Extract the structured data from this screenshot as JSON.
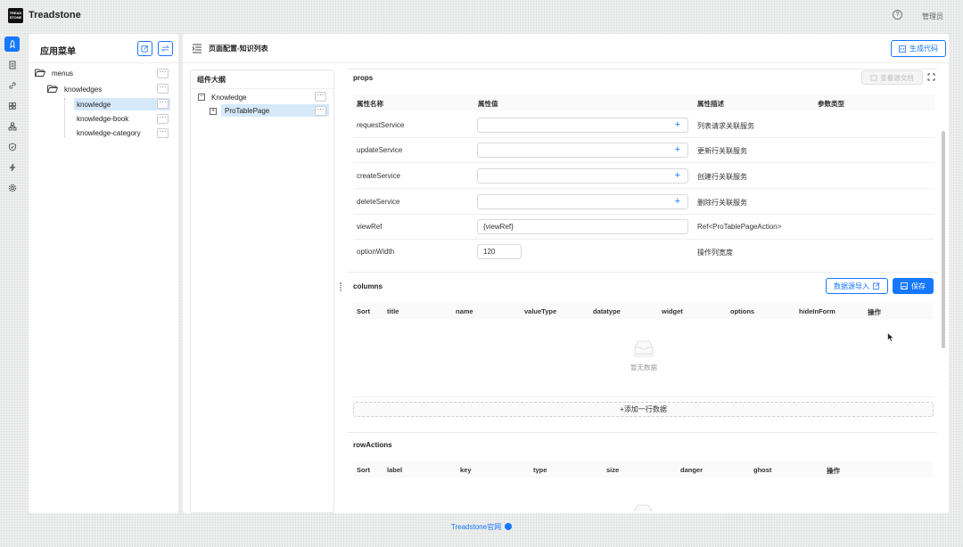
{
  "header": {
    "logo_text": "TREAD STONE",
    "app_title": "Treadstone",
    "user": "管理员"
  },
  "left_panel": {
    "title": "应用菜单",
    "tree": [
      {
        "label": "menus"
      },
      {
        "label": "knowledges"
      },
      {
        "label": "knowledge"
      },
      {
        "label": "knowledge-book"
      },
      {
        "label": "knowledge-category"
      }
    ],
    "more": "···"
  },
  "main": {
    "page_title": "页面配置-知识列表",
    "generate_label": "生成代码",
    "outline": {
      "title": "组件大纲",
      "tree": [
        {
          "label": "Knowledge"
        },
        {
          "label": "ProTablePage"
        }
      ]
    },
    "props": {
      "title": "props",
      "doc_label": "查看源文档",
      "headers": [
        "属性名称",
        "属性值",
        "属性描述",
        "参数类型"
      ],
      "rows": [
        {
          "name": "requestService",
          "value": "",
          "desc": "列表请求关联服务"
        },
        {
          "name": "updateService",
          "value": "",
          "desc": "更新行关联服务"
        },
        {
          "name": "createService",
          "value": "",
          "desc": "创建行关联服务"
        },
        {
          "name": "deleteService",
          "value": "",
          "desc": "删除行关联服务"
        },
        {
          "name": "viewRef",
          "value": "{viewRef}",
          "desc": "Ref<ProTablePageAction>"
        },
        {
          "name": "optionWidth",
          "value": "120",
          "desc": "操作列宽度"
        }
      ]
    },
    "columns": {
      "title": "columns",
      "import_label": "数据源导入",
      "save_label": "保存",
      "headers": [
        "Sort",
        "title",
        "name",
        "valueType",
        "datatype",
        "widget",
        "options",
        "hideInForm",
        "操作"
      ],
      "empty_text": "暂无数据",
      "add_row_label": "+添加一行数据"
    },
    "row_actions": {
      "title": "rowActions",
      "headers": [
        "Sort",
        "label",
        "key",
        "type",
        "size",
        "danger",
        "ghost",
        "操作"
      ]
    }
  },
  "footer": {
    "link": "Treadstone官网"
  }
}
